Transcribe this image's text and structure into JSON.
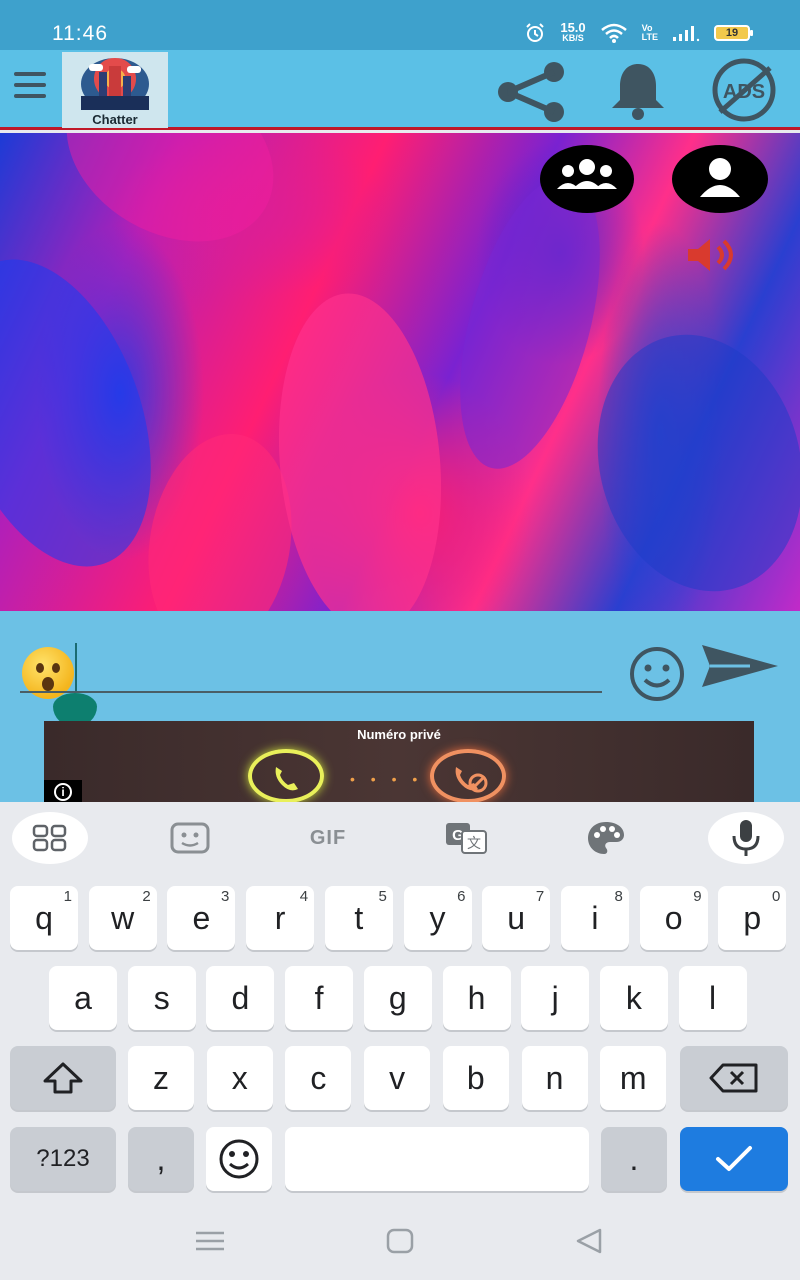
{
  "status_bar": {
    "time": "11:46",
    "net_speed_value": "15.0",
    "net_speed_unit": "KB/S",
    "volte_top": "Vo",
    "volte_bottom": "LTE",
    "battery": "19",
    "icons": [
      "alarm-icon",
      "wifi-icon",
      "signal-icon",
      "battery-icon"
    ]
  },
  "app_bar": {
    "logo_label": "Chatter",
    "icons": [
      "menu-icon",
      "share-icon",
      "bell-icon",
      "ads-off-icon"
    ],
    "colors": {
      "bar": "#5bc0e6",
      "accent_line": "#c01828",
      "icon": "#3f5561"
    }
  },
  "stage": {
    "icons": [
      "group-icon",
      "profile-icon",
      "speaker-icon"
    ]
  },
  "composer": {
    "input_value": "",
    "input_placeholder": "",
    "icons": [
      "surprised-emoji-icon",
      "smile-icon",
      "send-icon"
    ]
  },
  "ad": {
    "title": "Numéro privé",
    "dots": "• • • •",
    "info": "i"
  },
  "keyboard": {
    "toolbar": {
      "gif": "GIF",
      "icons": [
        "apps-grid-icon",
        "sticker-icon",
        "translate-icon",
        "palette-icon",
        "mic-icon"
      ]
    },
    "row1": [
      {
        "k": "q",
        "h": "1"
      },
      {
        "k": "w",
        "h": "2"
      },
      {
        "k": "e",
        "h": "3"
      },
      {
        "k": "r",
        "h": "4"
      },
      {
        "k": "t",
        "h": "5"
      },
      {
        "k": "y",
        "h": "6"
      },
      {
        "k": "u",
        "h": "7"
      },
      {
        "k": "i",
        "h": "8"
      },
      {
        "k": "o",
        "h": "9"
      },
      {
        "k": "p",
        "h": "0"
      }
    ],
    "row2": [
      "a",
      "s",
      "d",
      "f",
      "g",
      "h",
      "j",
      "k",
      "l"
    ],
    "row3": [
      "z",
      "x",
      "c",
      "v",
      "b",
      "n",
      "m"
    ],
    "symbols_key": "?123",
    "comma_key": ",",
    "period_key": ".",
    "colors": {
      "enter": "#1e7ce0",
      "gray_key": "#c9cdd3"
    }
  },
  "navbar": {
    "icons": [
      "recents-icon",
      "home-icon",
      "back-icon"
    ]
  }
}
